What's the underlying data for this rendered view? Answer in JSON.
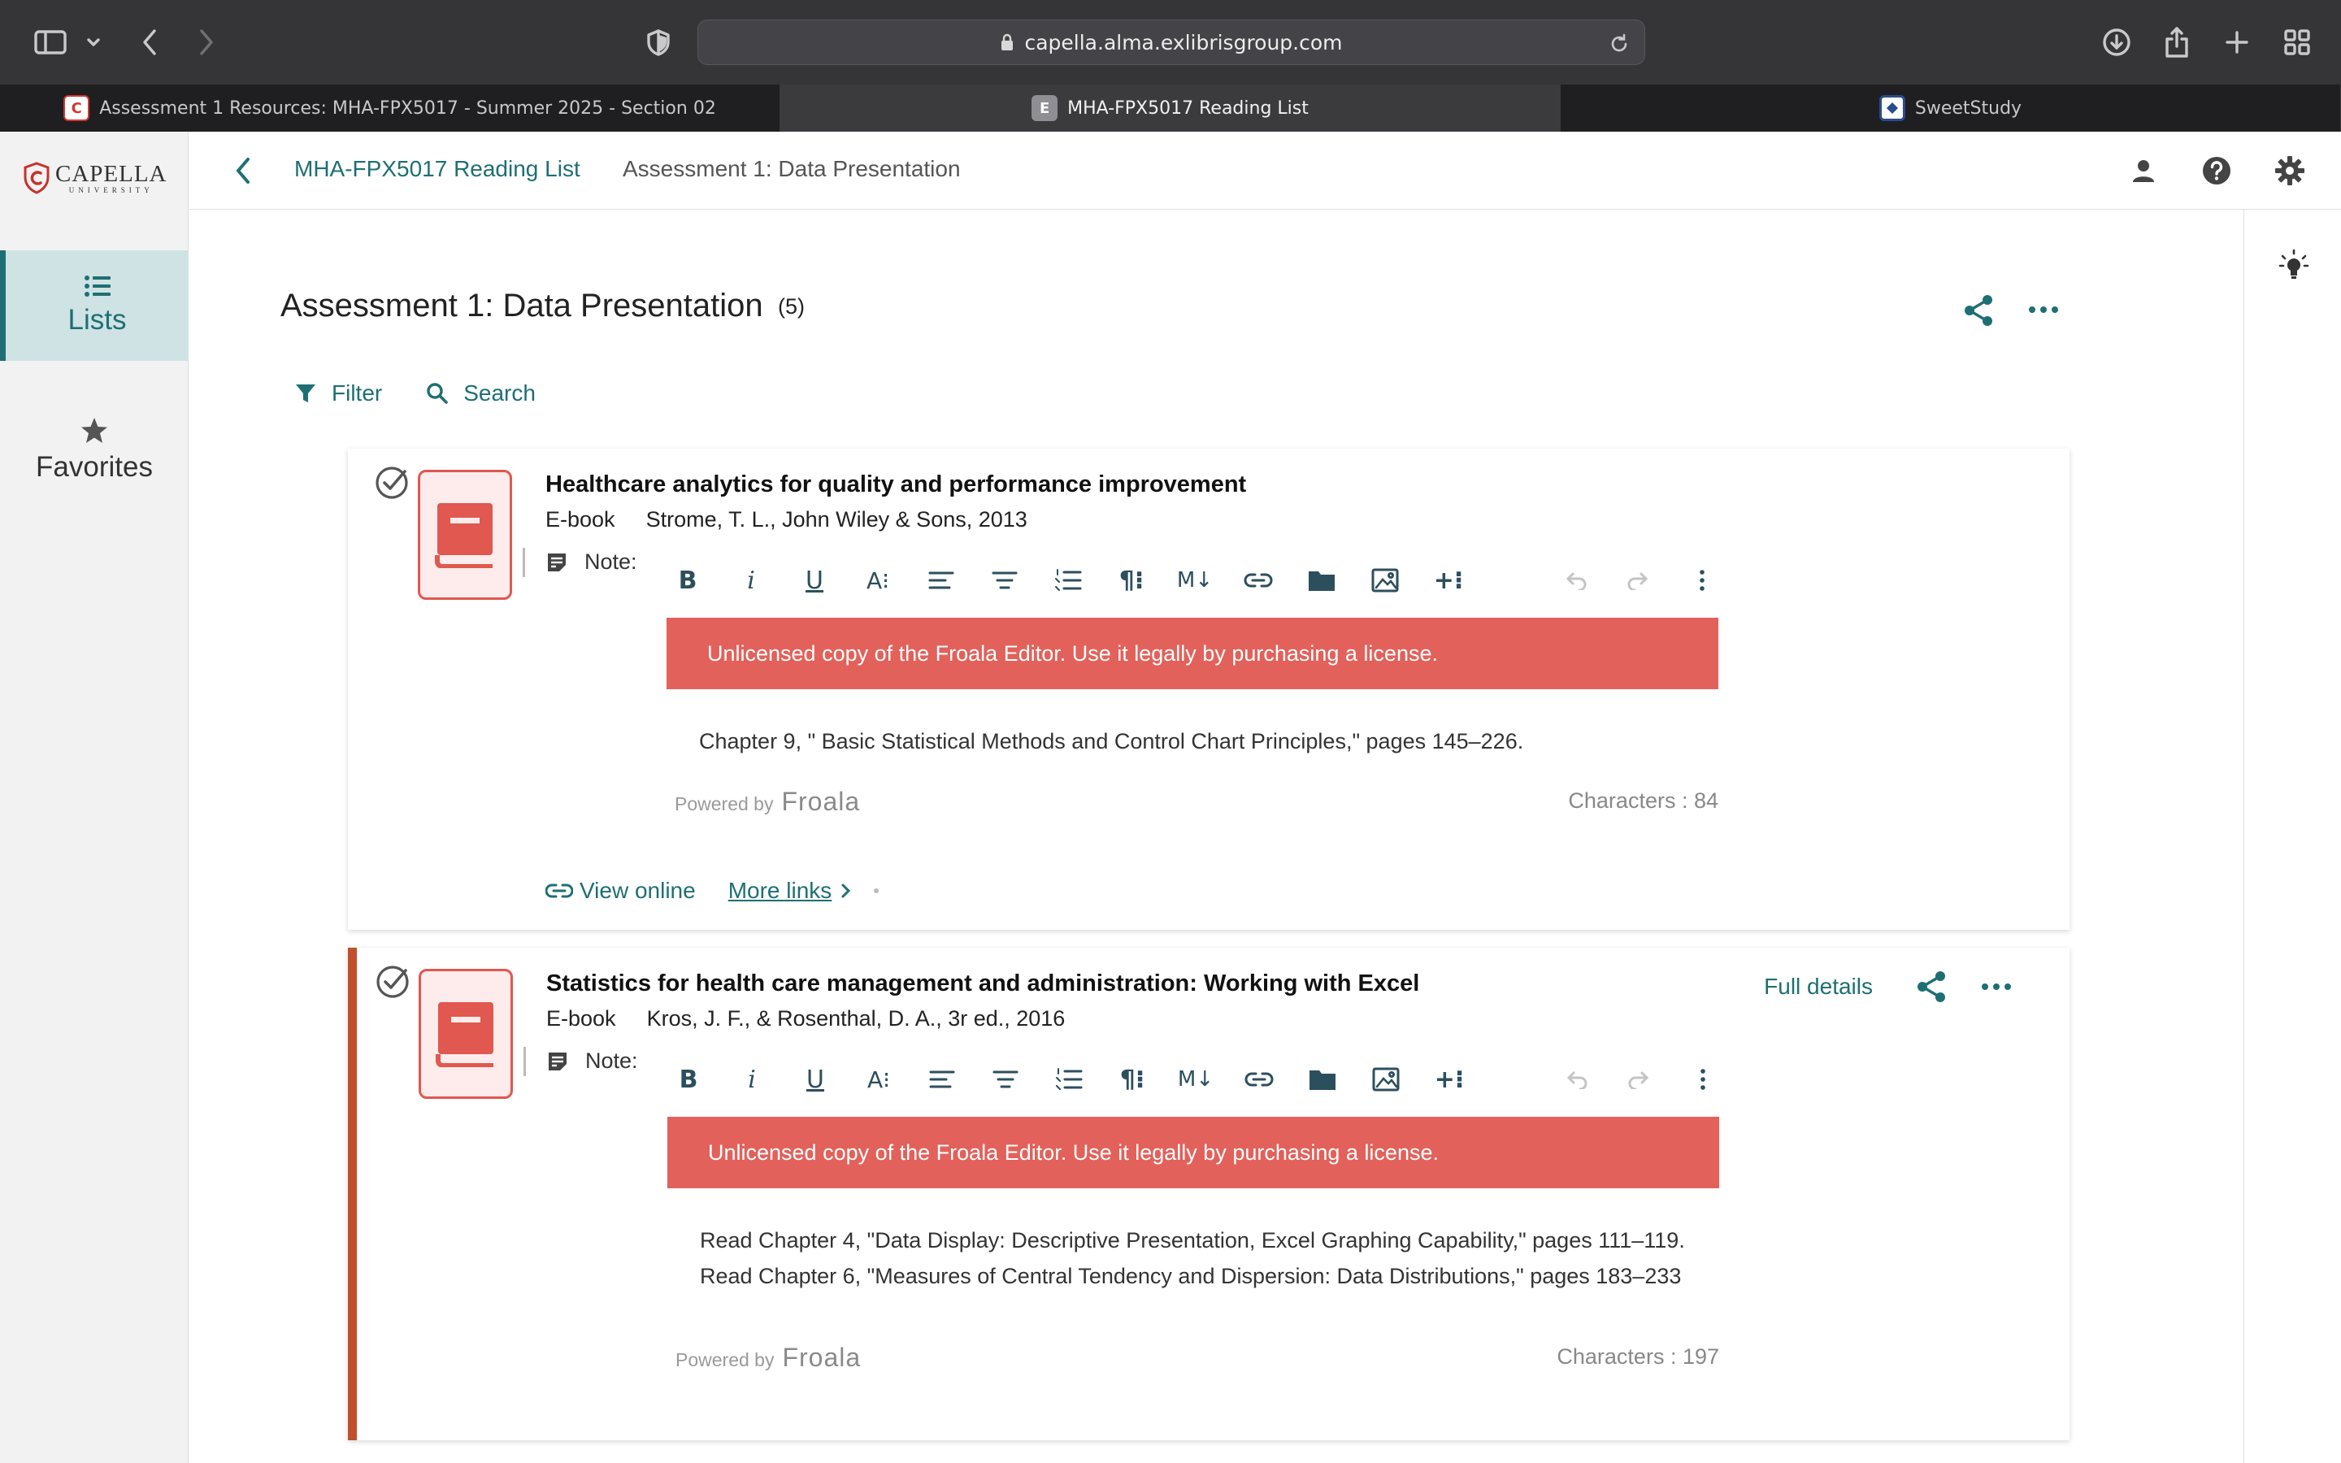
{
  "browser": {
    "url": "capella.alma.exlibrisgroup.com",
    "tabs": [
      {
        "label": "Assessment 1 Resources: MHA-FPX5017 - Summer 2025 - Section 02",
        "favicon_color": "#d2372f"
      },
      {
        "label": "MHA-FPX5017 Reading List",
        "favicon_letter": "E",
        "active": true
      },
      {
        "label": "SweetStudy",
        "favicon_color": "#2b4b8c"
      }
    ]
  },
  "sidebar": {
    "logo_main": "CAPELLA",
    "logo_sub": "UNIVERSITY",
    "items": [
      {
        "label": "Lists",
        "icon": "list-icon",
        "active": true
      },
      {
        "label": "Favorites",
        "icon": "star-icon",
        "active": false
      }
    ]
  },
  "breadcrumb": {
    "parent": "MHA-FPX5017 Reading List",
    "current": "Assessment 1: Data Presentation"
  },
  "section": {
    "title": "Assessment 1: Data Presentation",
    "count": "(5)",
    "filter_label": "Filter",
    "search_label": "Search"
  },
  "editor": {
    "banner": "Unlicensed copy of the Froala Editor. Use it legally by purchasing a license.",
    "powered_by": "Powered by",
    "brand": "Froala",
    "note_label": "Note:"
  },
  "items": [
    {
      "title": "Healthcare analytics for quality and performance improvement",
      "type": "E-book",
      "citation": "Strome, T. L., John Wiley & Sons, 2013",
      "note": "Chapter 9, \" Basic Statistical Methods and Control Chart Principles,\" pages 145–226.",
      "characters": "Characters : 84",
      "view_online": "View online",
      "more_links": "More links"
    },
    {
      "title": "Statistics for health care management and administration: Working with Excel",
      "type": "E-book",
      "citation": "Kros, J. F., & Rosenthal, D. A., 3r ed., 2016",
      "note": "Read Chapter 4, \"Data Display: Descriptive Presentation, Excel Graphing Capability,\" pages 111–119. Read Chapter 6, \"Measures of Central Tendency and Dispersion: Data Distributions,\" pages 183–233",
      "characters": "Characters : 197",
      "full_details": "Full details"
    }
  ],
  "colors": {
    "accent": "#1e6f73",
    "banner": "#e2615a",
    "book": "#e0584f",
    "selected_bar": "#c0502b"
  }
}
